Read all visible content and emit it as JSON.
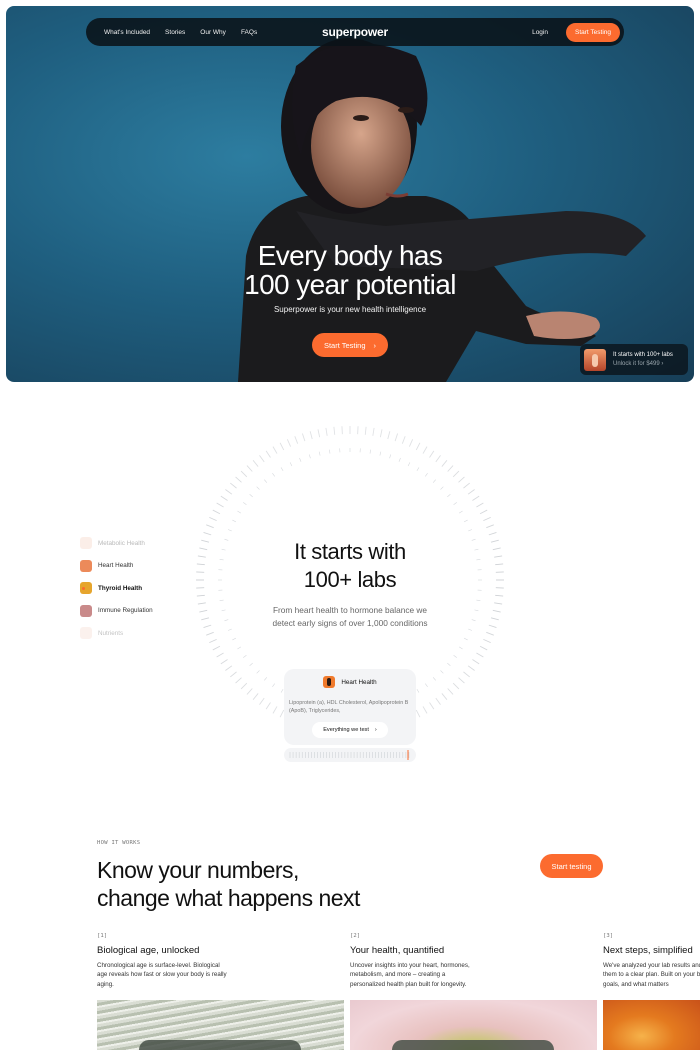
{
  "nav": {
    "links": [
      "What's Included",
      "Stories",
      "Our Why",
      "FAQs"
    ],
    "logo": "superpower",
    "login": "Login",
    "cta": "Start Testing"
  },
  "hero": {
    "title_line1": "Every body has",
    "title_line2": "100 year potential",
    "subtitle": "Superpower is your new health intelligence",
    "cta": "Start Testing",
    "cta_chevron": "›",
    "promo": {
      "title": "It starts with 100+ labs",
      "subtitle": "Unlock it for $499 ›"
    }
  },
  "labs": {
    "categories": [
      {
        "label": "Metabolic Health",
        "color": "#f4cfc0",
        "opacity": 0.35
      },
      {
        "label": "Heart Health",
        "color": "#ec8a5a",
        "opacity": 1
      },
      {
        "label": "Thyroid Health",
        "color": "#e6a52d",
        "opacity": 1,
        "active": true
      },
      {
        "label": "Immune Regulation",
        "color": "#c98a8a",
        "opacity": 1
      },
      {
        "label": "Nutrients",
        "color": "#f4d2c6",
        "opacity": 0.3
      }
    ],
    "title_line1": "It starts with",
    "title_line2": "100+ labs",
    "subtitle_line1": "From heart health to hormone balance we",
    "subtitle_line2": "detect early signs of over 1,000 conditions",
    "card": {
      "title": "Heart Health",
      "body": "Lipoprotein (a), HDL Cholesterol, Apolipoprotein B (ApoB), Triglycerides,",
      "button": "Everything we test",
      "button_chevron": "›"
    },
    "accent": "#fc6b2f"
  },
  "how": {
    "eyebrow": "HOW IT WORKS",
    "title_line1": "Know your numbers,",
    "title_line2": "change what happens next",
    "cta": "Start testing",
    "steps": [
      {
        "num": "[1]",
        "title": "Biological age, unlocked",
        "body": "Chronological age is surface-level. Biological age reveals how fast or slow your body is really aging."
      },
      {
        "num": "[2]",
        "title": "Your health, quantified",
        "body": "Uncover insights into your heart, hormones, metabolism, and more – creating a personalized health plan built for longevity."
      },
      {
        "num": "[3]",
        "title": "Next steps, simplified",
        "body": "We've analyzed your lab results and translated them to a clear plan. Built on your biology, goals, and what matters"
      }
    ]
  }
}
